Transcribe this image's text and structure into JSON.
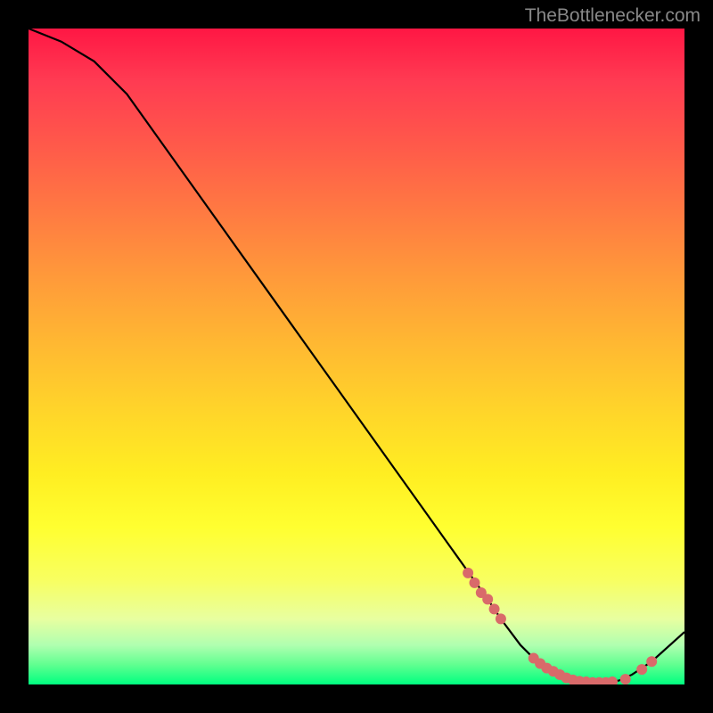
{
  "attribution": "TheBottlenecker.com",
  "chart_data": {
    "type": "line",
    "title": "",
    "xlabel": "",
    "ylabel": "",
    "xlim": [
      0,
      100
    ],
    "ylim": [
      0,
      100
    ],
    "series": [
      {
        "name": "curve",
        "x": [
          0,
          5,
          10,
          15,
          20,
          25,
          30,
          35,
          40,
          45,
          50,
          55,
          60,
          65,
          70,
          72,
          75,
          78,
          80,
          82,
          84,
          86,
          88,
          90,
          92,
          95,
          100
        ],
        "y": [
          100,
          98,
          95,
          90,
          83,
          76,
          69,
          62,
          55,
          48,
          41,
          34,
          27,
          20,
          13,
          10,
          6,
          3,
          2,
          1,
          0.5,
          0.3,
          0.3,
          0.6,
          1.5,
          3.5,
          8
        ]
      }
    ],
    "markers": {
      "name": "highlight-points",
      "color": "#d96a6a",
      "x": [
        67,
        68,
        69,
        70,
        71,
        72,
        77,
        78,
        79,
        80,
        81,
        82,
        83,
        84,
        85,
        86,
        87,
        88,
        89,
        91,
        93.5,
        95
      ],
      "y": [
        17,
        15.5,
        14,
        13,
        11.5,
        10,
        4,
        3.2,
        2.5,
        2,
        1.5,
        1,
        0.7,
        0.5,
        0.4,
        0.3,
        0.3,
        0.3,
        0.4,
        0.8,
        2.3,
        3.5
      ]
    }
  }
}
